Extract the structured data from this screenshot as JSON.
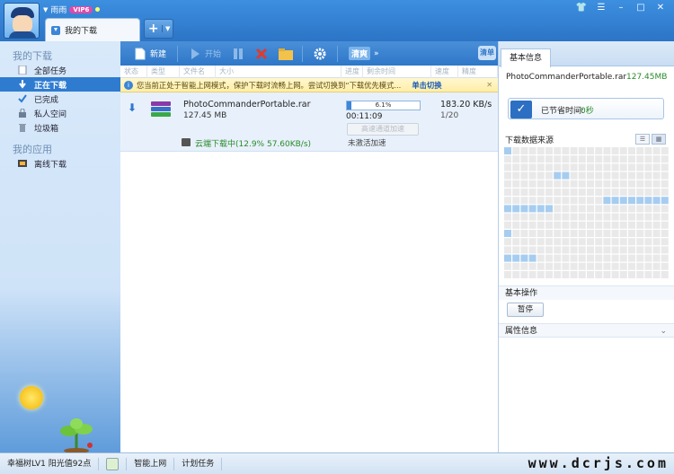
{
  "user": {
    "name": "雨雨",
    "vip": "VIP6"
  },
  "tabs": [
    {
      "label": "我的下载"
    }
  ],
  "sidebar": {
    "sections": [
      {
        "title": "我的下载",
        "items": [
          {
            "label": "全部任务",
            "icon": "document-icon"
          },
          {
            "label": "正在下载",
            "icon": "download-arrow-icon"
          },
          {
            "label": "已完成",
            "icon": "checkmark-icon"
          },
          {
            "label": "私人空间",
            "icon": "lock-icon"
          },
          {
            "label": "垃圾箱",
            "icon": "trash-icon"
          }
        ]
      },
      {
        "title": "我的应用",
        "items": [
          {
            "label": "离线下载",
            "icon": "offline-download-icon"
          }
        ]
      }
    ]
  },
  "toolbar": {
    "new_label": "新建",
    "start_label": "开始",
    "cleanup_label": "清爽",
    "view_label": "清单"
  },
  "columns": [
    "状态",
    "类型",
    "文件名",
    "大小",
    "进度",
    "剩余时间",
    "速度",
    "精度"
  ],
  "notice": {
    "text": "您当前正处于智能上网模式，保护下载时流畅上网。尝试切换到“下载优先模式...",
    "link": "单击切换",
    "close": "✕"
  },
  "task": {
    "filename": "PhotoCommanderPortable.rar",
    "size": "127.45 MB",
    "progress": 0.061,
    "progress_text": "6.1%",
    "elapsed": "00:11:09",
    "speed": "183.20 KB/s",
    "connections": "1/20",
    "accel_button": "高速通道加速",
    "cloud_status": "云端下载中(12.9% 57.60KB/s)",
    "not_activated": "未激活加速"
  },
  "right_panel": {
    "tab": "基本信息",
    "filename": "PhotoCommanderPortable.rar",
    "filesize": "127.45MB",
    "saved_label": "已节省时间:",
    "saved_value": "0秒",
    "source_title": "下载数据来源",
    "ops_title": "基本操作",
    "pause_label": "暂停",
    "props_title": "属性信息"
  },
  "status_bar": {
    "level": "幸福树LV1 阳光值92点",
    "mode": "智能上网",
    "plan": "计划任务"
  },
  "watermark": "www.dcrjs.com",
  "colors": {
    "accent": "#2f7bd0",
    "progress": "#3d86d8",
    "green": "#2a8a2a",
    "grid_fill": "#a6cdf0",
    "grid_empty": "#e9e9e9"
  }
}
